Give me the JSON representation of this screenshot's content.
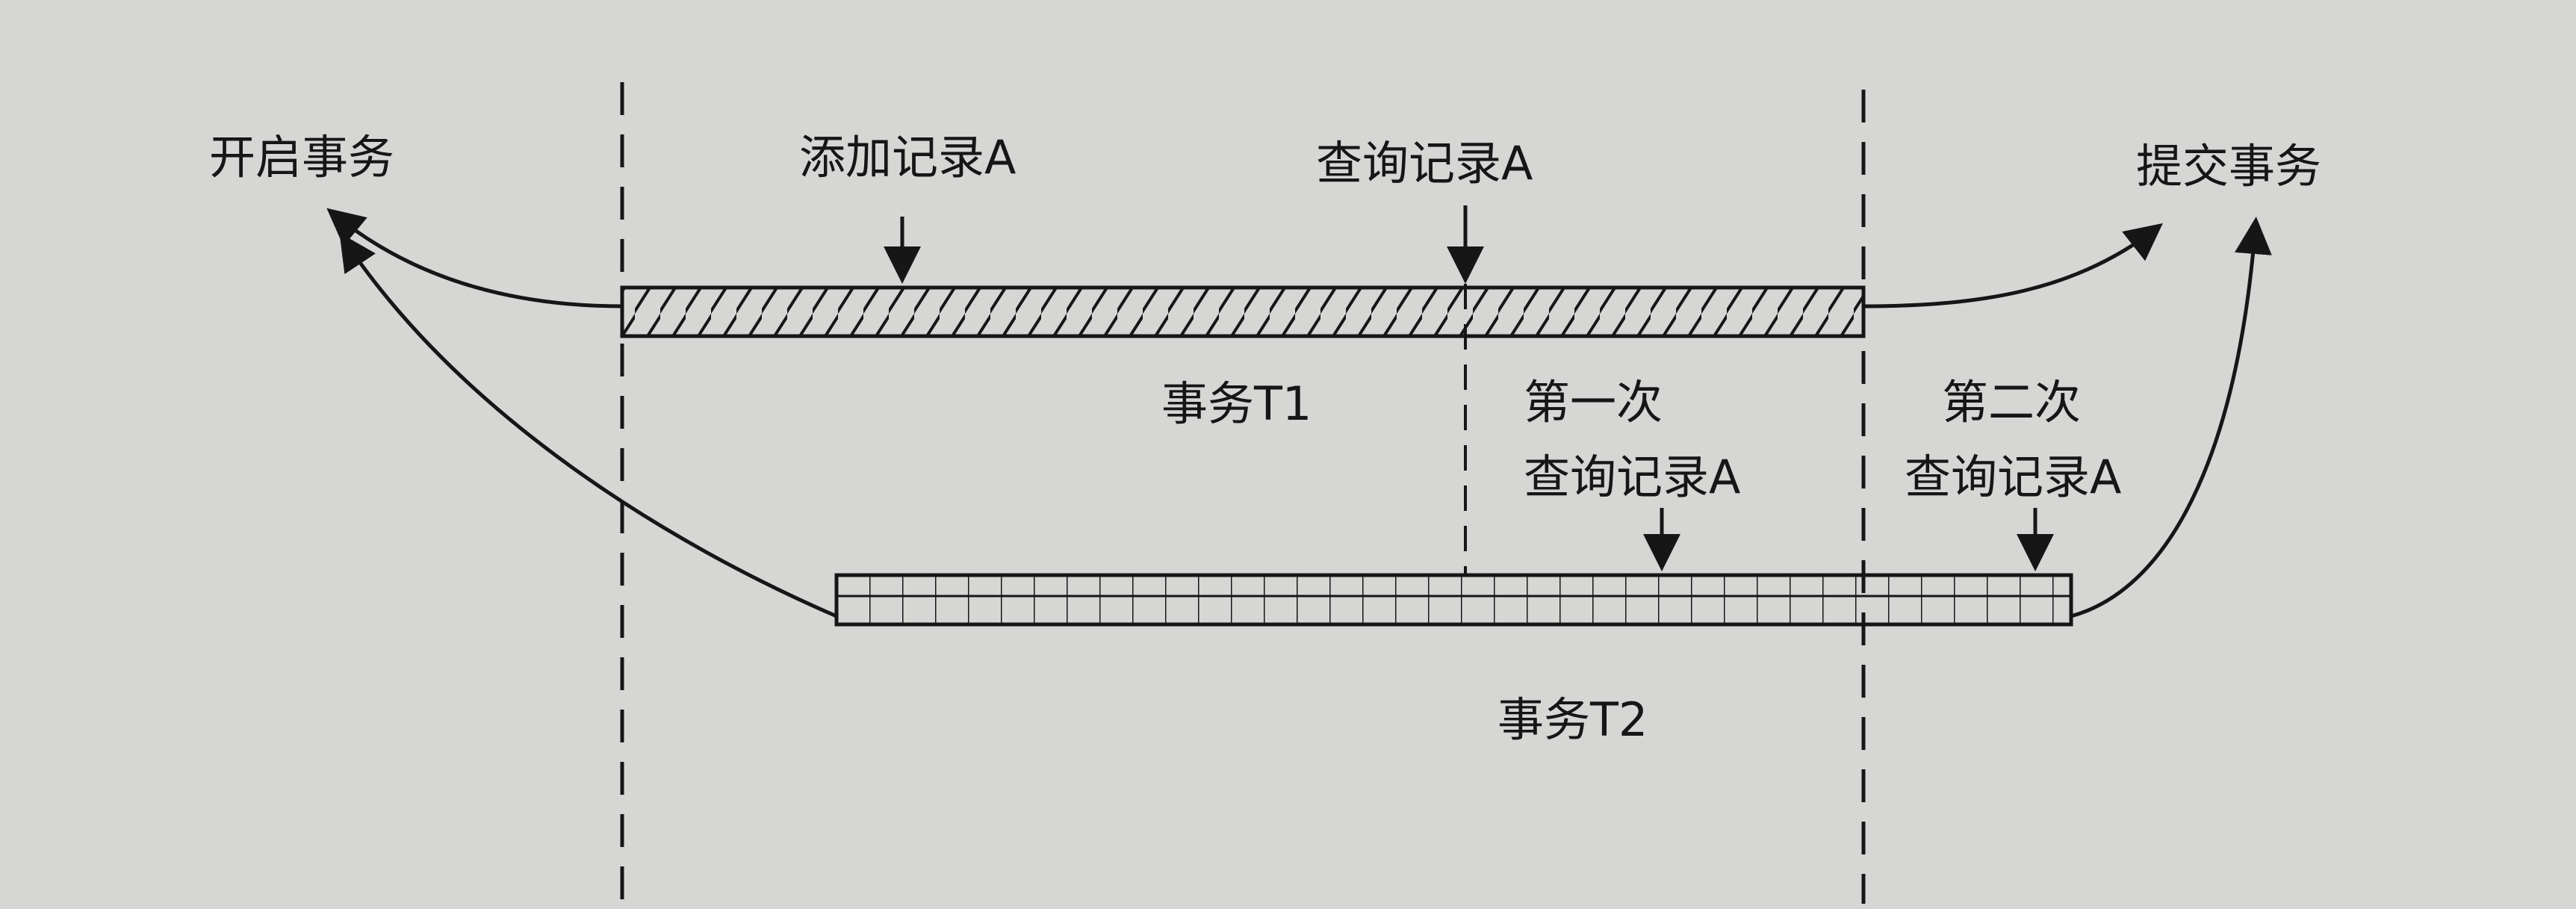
{
  "diagram": {
    "labels": {
      "start_tx": "开启事务",
      "add_record": "添加记录A",
      "query_record": "查询记录A",
      "commit_tx": "提交事务",
      "tx1": "事务T1",
      "first_query_line1": "第一次",
      "first_query_line2": "查询记录A",
      "second_query_line1": "第二次",
      "second_query_line2": "查询记录A",
      "tx2": "事务T2"
    },
    "colors": {
      "background": "#d6d6d4",
      "ink": "#161616"
    }
  }
}
